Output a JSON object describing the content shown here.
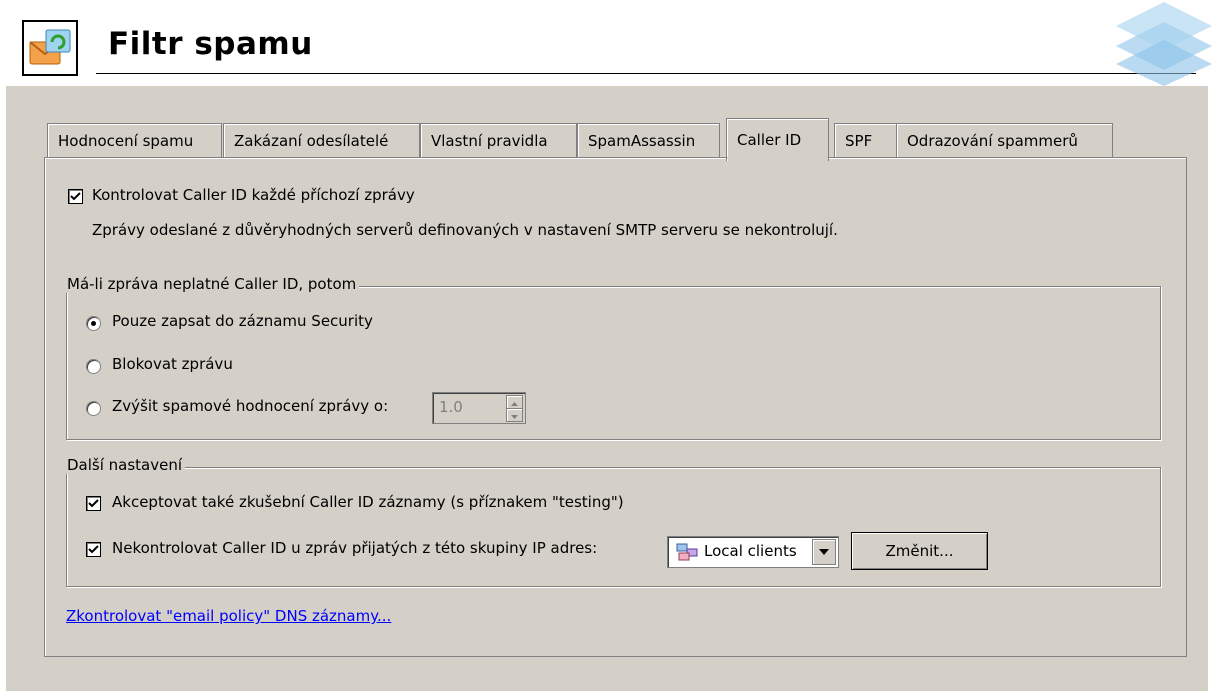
{
  "header": {
    "title": "Filtr spamu"
  },
  "tabs": [
    {
      "label": "Hodnocení spamu"
    },
    {
      "label": "Zakázaní odesílatelé"
    },
    {
      "label": "Vlastní pravidla"
    },
    {
      "label": "SpamAssassin"
    },
    {
      "label": "Caller ID"
    },
    {
      "label": "SPF"
    },
    {
      "label": "Odrazování spammerů"
    }
  ],
  "active_tab": "Caller ID",
  "caller_id": {
    "check_label": "Kontrolovat Caller ID každé příchozí zprávy",
    "check_checked": true,
    "note": "Zprávy odeslané z důvěryhodných serverů definovaných v nastavení SMTP serveru se nekontrolují."
  },
  "invalid_group": {
    "title": "Má-li zpráva neplatné Caller ID, potom",
    "options": [
      {
        "label": "Pouze zapsat do záznamu Security",
        "selected": true
      },
      {
        "label": "Blokovat zprávu",
        "selected": false
      },
      {
        "label": "Zvýšit spamové hodnocení zprávy o:",
        "selected": false
      }
    ],
    "spin_value": "1.0"
  },
  "other_group": {
    "title": "Další nastavení",
    "accept_testing_label": "Akceptovat také zkušební Caller ID záznamy (s příznakem \"testing\")",
    "accept_testing_checked": true,
    "skip_ip_label": "Nekontrolovat Caller ID u zpráv přijatých z této skupiny IP adres:",
    "skip_ip_checked": true,
    "ip_group_value": "Local clients",
    "change_button": "Změnit..."
  },
  "dns_link": "Zkontrolovat \"email policy\" DNS záznamy..."
}
